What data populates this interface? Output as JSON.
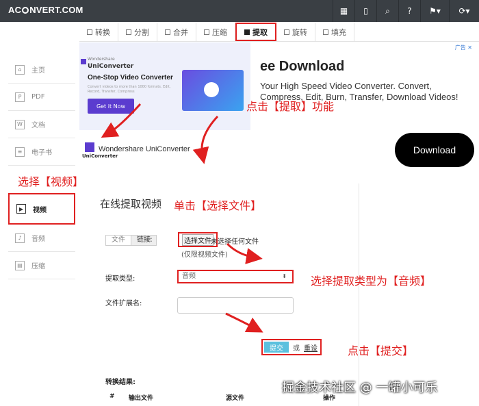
{
  "topbar": {
    "logo_pre": "AC",
    "logo_post": "NVERT.COM"
  },
  "tabs": [
    {
      "label": "转换",
      "active": false
    },
    {
      "label": "分割",
      "active": false
    },
    {
      "label": "合并",
      "active": false
    },
    {
      "label": "压缩",
      "active": false
    },
    {
      "label": "提取",
      "active": true
    },
    {
      "label": "旋转",
      "active": false
    },
    {
      "label": "填充",
      "active": false
    }
  ],
  "sidebar": [
    {
      "label": "主页",
      "icon": "home-icon"
    },
    {
      "label": "PDF",
      "icon": "pdf-icon"
    },
    {
      "label": "文档",
      "icon": "word-icon"
    },
    {
      "label": "电子书",
      "icon": "ebook-icon"
    },
    {
      "label": "视频",
      "icon": "video-icon",
      "active": true
    },
    {
      "label": "音频",
      "icon": "audio-icon"
    },
    {
      "label": "压缩",
      "icon": "archive-icon"
    }
  ],
  "ad": {
    "brand": "Wondershare",
    "brand_product": "UniConverter",
    "tagline": "One-Stop Video Converter",
    "small_text": "Convert videos to more than 1000 formats. Edit, Record, Transfer, Compress",
    "cta": "Get it Now",
    "sub_brand": "Wondershare UniConverter",
    "title_tail": "ee Download",
    "description": "Your High Speed Video Converter. Convert, Compress, Edit, Burn, Transfer, Download Videos!",
    "button": "Download",
    "adchoice": "广告 ✕"
  },
  "content": {
    "heading": "在线提取视频",
    "source_tab_file": "文件",
    "source_tab_link": "链接",
    "colon": ":",
    "choose_file": "选择文件",
    "no_file": "未选择任何文件",
    "hint": "(仅限视频文件)",
    "type_label": "提取类型:",
    "type_value": "音频",
    "ext_label": "文件扩展名:",
    "submit": "提交",
    "or": "或",
    "reset": "重设",
    "result_label": "转换结果:",
    "col_hash": "#",
    "col_output": "输出文件",
    "col_source": "源文件",
    "col_action": "操作"
  },
  "annotations": {
    "click_extract": "点击【提取】功能",
    "select_video": "选择【视频】",
    "click_choose": "单击【选择文件】",
    "select_type": "选择提取类型为【音频】",
    "click_submit": "点击【提交】"
  },
  "watermark": "掘金技术社区 @ 一罐小可乐",
  "colors": {
    "annotation": "#e02020",
    "topbar": "#3a3f44",
    "submit": "#5bc0de",
    "brand": "#5b3ccf"
  }
}
